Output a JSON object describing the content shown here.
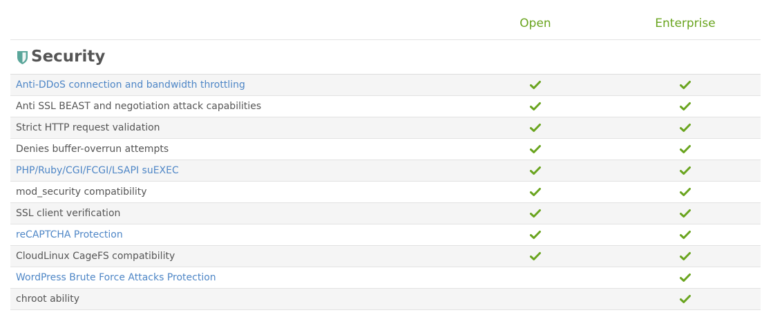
{
  "colors": {
    "accent_green": "#69a41e",
    "link_blue": "#4e86c6",
    "text_gray": "#555555",
    "shield_teal": "#5aa69a"
  },
  "columns": {
    "open": "Open",
    "enterprise": "Enterprise"
  },
  "section": {
    "icon": "shield-icon",
    "title": "Security"
  },
  "features": [
    {
      "label": "Anti-DDoS connection and bandwidth throttling",
      "link": true,
      "open": true,
      "enterprise": true
    },
    {
      "label": "Anti SSL BEAST and negotiation attack capabilities",
      "link": false,
      "open": true,
      "enterprise": true
    },
    {
      "label": "Strict HTTP request validation",
      "link": false,
      "open": true,
      "enterprise": true
    },
    {
      "label": "Denies buffer-overrun attempts",
      "link": false,
      "open": true,
      "enterprise": true
    },
    {
      "label": "PHP/Ruby/CGI/FCGI/LSAPI suEXEC",
      "link": true,
      "open": true,
      "enterprise": true
    },
    {
      "label": "mod_security compatibility",
      "link": false,
      "open": true,
      "enterprise": true
    },
    {
      "label": "SSL client verification",
      "link": false,
      "open": true,
      "enterprise": true
    },
    {
      "label": "reCAPTCHA Protection",
      "link": true,
      "open": true,
      "enterprise": true
    },
    {
      "label": "CloudLinux CageFS compatibility",
      "link": false,
      "open": true,
      "enterprise": true
    },
    {
      "label": "WordPress Brute Force Attacks Protection",
      "link": true,
      "open": false,
      "enterprise": true
    },
    {
      "label": "chroot ability",
      "link": false,
      "open": false,
      "enterprise": true
    }
  ]
}
